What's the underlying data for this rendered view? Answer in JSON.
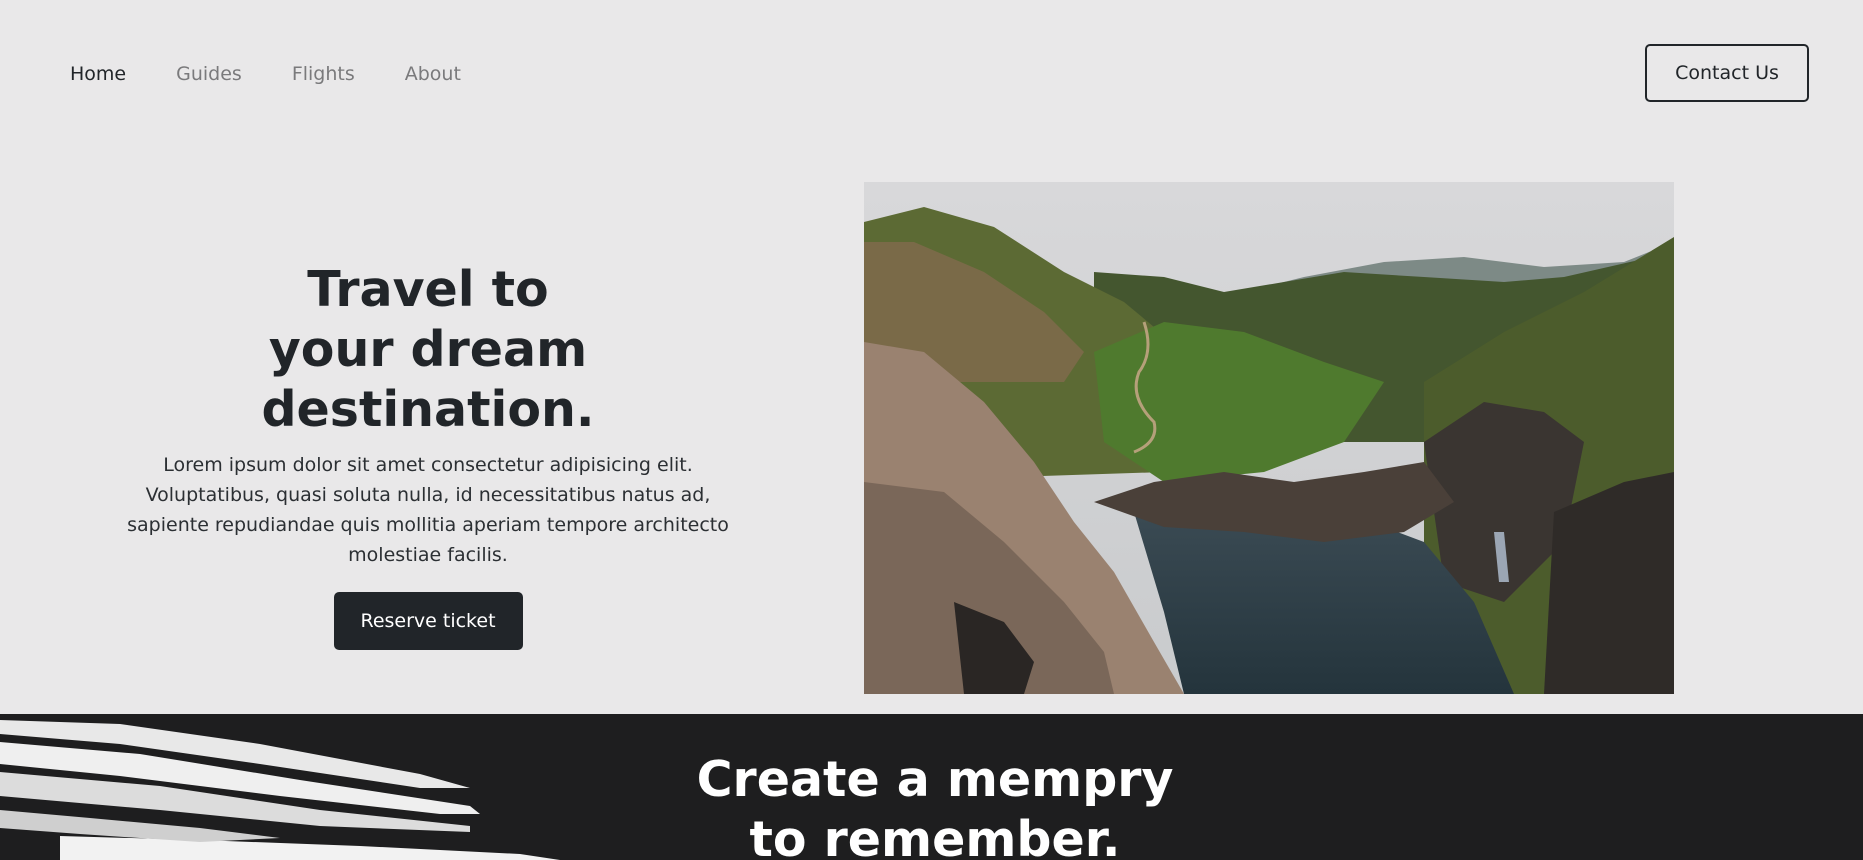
{
  "nav": {
    "links": [
      {
        "label": "Home",
        "active": true
      },
      {
        "label": "Guides",
        "active": false
      },
      {
        "label": "Flights",
        "active": false
      },
      {
        "label": "About",
        "active": false
      }
    ],
    "contact_label": "Contact Us"
  },
  "hero": {
    "title_line1": "Travel to",
    "title_line2": "your dream",
    "title_line3": "destination.",
    "description": "Lorem ipsum dolor sit amet consectetur adipisicing elit. Voluptatibus, quasi soluta nulla, id necessitatibus natus ad, sapiente repudiandae quis mollitia aperiam tempore architecto molestiae facilis.",
    "button_label": "Reserve ticket",
    "image": "coastal-cliffs-river-valley-photo"
  },
  "memory_section": {
    "title_line1": "Create a mempry",
    "title_line2": "to remember."
  },
  "colors": {
    "background": "#e9e8e9",
    "dark": "#212529",
    "section_dark": "#1e1e1f",
    "nav_inactive": "#7a7a7c"
  }
}
